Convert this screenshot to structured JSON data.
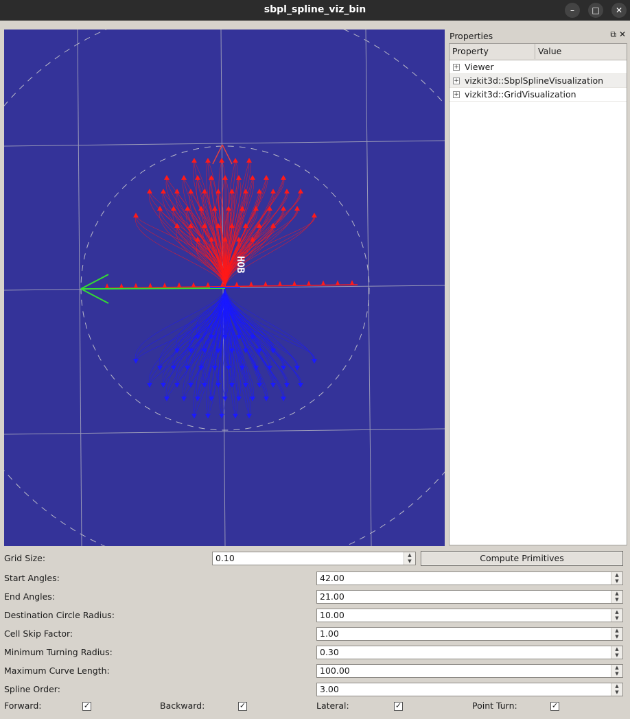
{
  "window": {
    "title": "sbpl_spline_viz_bin",
    "minimize_icon": "minimize-icon",
    "maximize_icon": "maximize-icon",
    "close_icon": "close-icon"
  },
  "viewport": {
    "background": "#343399",
    "label": "HOB",
    "colors": {
      "forward": "#ff1a1a",
      "backward": "#1a1aff",
      "axis_x": "#33dd33",
      "grid": "#9a9ab0"
    }
  },
  "properties": {
    "title": "Properties",
    "columns": [
      "Property",
      "Value"
    ],
    "items": [
      {
        "label": "Viewer"
      },
      {
        "label": "vizkit3d::SbplSplineVisualization"
      },
      {
        "label": "vizkit3d::GridVisualization"
      }
    ]
  },
  "form": {
    "grid_size": {
      "label": "Grid Size:",
      "value": "0.10"
    },
    "compute_button": "Compute Primitives",
    "fields": [
      {
        "label": "Start Angles:",
        "value": "42.00"
      },
      {
        "label": "End Angles:",
        "value": "21.00"
      },
      {
        "label": "Destination Circle Radius:",
        "value": "10.00"
      },
      {
        "label": "Cell Skip Factor:",
        "value": "1.00"
      },
      {
        "label": "Minimum Turning Radius:",
        "value": "0.30"
      },
      {
        "label": "Maximum Curve Length:",
        "value": "100.00"
      },
      {
        "label": "Spline Order:",
        "value": "3.00"
      }
    ],
    "checkboxes": [
      {
        "label": "Forward:",
        "checked": true
      },
      {
        "label": "Backward:",
        "checked": true
      },
      {
        "label": "Lateral:",
        "checked": true
      },
      {
        "label": "Point Turn:",
        "checked": true
      }
    ]
  }
}
